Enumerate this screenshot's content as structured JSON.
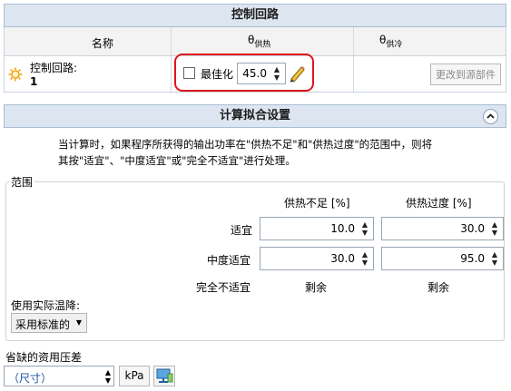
{
  "control_panel": {
    "title": "控制回路",
    "col_name": "名称",
    "col_heat": "θ",
    "col_heat_sub": "供热",
    "col_cool": "θ",
    "col_cool_sub": "供冷",
    "row": {
      "name_line1": "控制回路:",
      "name_line2": "1",
      "optimize_label": "最佳化",
      "optimize_checked": false,
      "heat_value": "45.0",
      "update_button": "更改到源部件"
    }
  },
  "fit_panel": {
    "title": "计算拟合设置",
    "desc_line1": "当计算时，如果程序所获得的输出功率在\"供热不足\"和\"供热过度\"的范围中，则将",
    "desc_line2": "其按\"适宜\"、\"中度适宜\"或\"完全不适宜\"进行处理。",
    "range_group": "范围",
    "col_under": "供热不足 [%]",
    "col_over": "供热过度 [%]",
    "rows": [
      {
        "label": "适宜",
        "under": "10.0",
        "over": "30.0"
      },
      {
        "label": "中度适宜",
        "under": "30.0",
        "over": "95.0"
      }
    ],
    "unsuitable_label": "完全不适宜",
    "remainder_under": "剩余",
    "remainder_over": "剩余",
    "temp_drop_label": "使用实际温降:",
    "temp_drop_value": "采用标准的"
  },
  "pressure": {
    "label": "省缺的资用压差",
    "value": "（尺寸）",
    "unit": "kPa"
  },
  "colors": {
    "header_bg": "#dde6f0",
    "highlight": "#e0141c",
    "sun": "#f2a20c"
  }
}
